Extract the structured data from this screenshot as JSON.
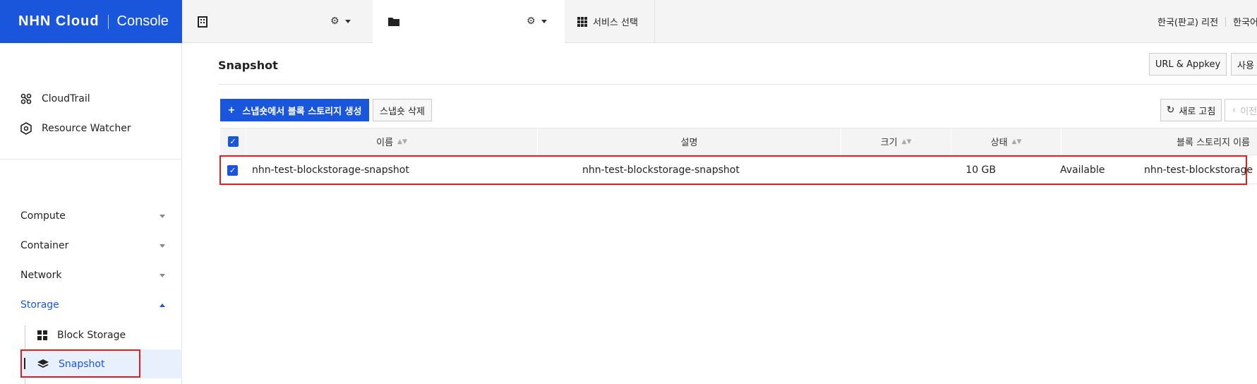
{
  "brand": {
    "logo": "NHN Cloud",
    "console": "Console"
  },
  "topbar": {
    "service_select": "서비스 선택",
    "region": "한국(판교) 리전",
    "language": "한국어"
  },
  "sidebar": {
    "tools": [
      {
        "label": "CloudTrail",
        "icon": "cloudtrail-icon"
      },
      {
        "label": "Resource Watcher",
        "icon": "resource-watcher-icon"
      }
    ],
    "categories": [
      {
        "label": "Compute",
        "open": false
      },
      {
        "label": "Container",
        "open": false
      },
      {
        "label": "Network",
        "open": false
      },
      {
        "label": "Storage",
        "open": true
      }
    ],
    "storage_items": [
      {
        "label": "Block Storage",
        "icon": "grid-icon"
      },
      {
        "label": "Snapshot",
        "icon": "layers-icon",
        "active": true
      }
    ]
  },
  "main": {
    "title": "Snapshot",
    "buttons": {
      "url_appkey": "URL & Appkey",
      "usage": "사용",
      "create": "스냅숏에서 블록 스토리지 생성",
      "delete": "스냅숏 삭제",
      "refresh": "새로 고침",
      "prev": "이전"
    },
    "table": {
      "headers": [
        "이름",
        "설명",
        "크기",
        "상태",
        "블록 스토리지 이름"
      ],
      "rows": [
        {
          "name": "nhn-test-blockstorage-snapshot",
          "description": "nhn-test-blockstorage-snapshot",
          "size": "10 GB",
          "status": "Available",
          "block_storage": "nhn-test-blockstorage",
          "checked": true
        }
      ]
    }
  },
  "colors": {
    "accent": "#1a56db",
    "highlight": "#e02020"
  }
}
